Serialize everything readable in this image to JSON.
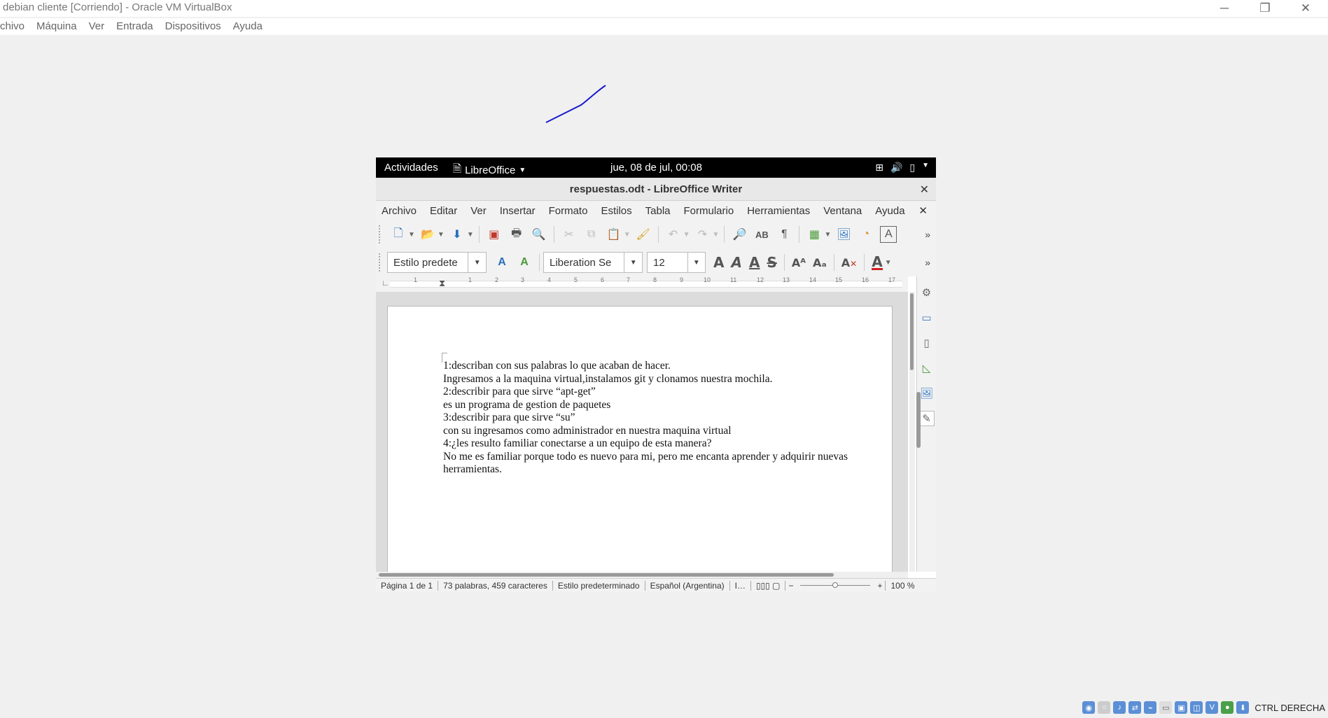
{
  "vbox": {
    "title": "debian cliente [Corriendo] - Oracle VM VirtualBox",
    "menu": [
      "chivo",
      "Máquina",
      "Ver",
      "Entrada",
      "Dispositivos",
      "Ayuda"
    ],
    "host_key": "CTRL DERECHA"
  },
  "gnome": {
    "activities": "Actividades",
    "app_name": "LibreOffice",
    "clock": "jue, 08 de jul, 00:08"
  },
  "writer": {
    "window_title": "respuestas.odt - LibreOffice Writer",
    "menu": [
      "Archivo",
      "Editar",
      "Ver",
      "Insertar",
      "Formato",
      "Estilos",
      "Tabla",
      "Formulario",
      "Herramientas",
      "Ventana",
      "Ayuda"
    ],
    "paragraph_style": "Estilo predete",
    "font_name": "Liberation Se",
    "font_size": "12",
    "ruler_numbers": [
      "1",
      "1",
      "2",
      "3",
      "4",
      "5",
      "6",
      "7",
      "8",
      "9",
      "10",
      "11",
      "12",
      "13",
      "14",
      "15",
      "16",
      "17"
    ],
    "document_lines": [
      "1:describan con sus palabras lo que acaban de hacer.",
      "Ingresamos a la maquina virtual,instalamos git y clonamos nuestra mochila.",
      "2:describir para que sirve “apt-get”",
      "es un programa de gestion de paquetes",
      "3:describir para que sirve “su”",
      "con su ingresamos como administrador en nuestra maquina virtual",
      "4:¿les resulto familiar conectarse a un equipo de esta manera?",
      "No me es familiar porque todo es nuevo para mi, pero me encanta aprender y adquirir nuevas",
      "herramientas."
    ],
    "status": {
      "page": "Página 1 de 1",
      "words": "73 palabras, 459 caracteres",
      "style": "Estilo predeterminado",
      "language": "Español (Argentina)",
      "zoom": "100 %"
    }
  },
  "colors": {
    "stroke": "#1a1acc",
    "gnome_bar": "#000000"
  }
}
